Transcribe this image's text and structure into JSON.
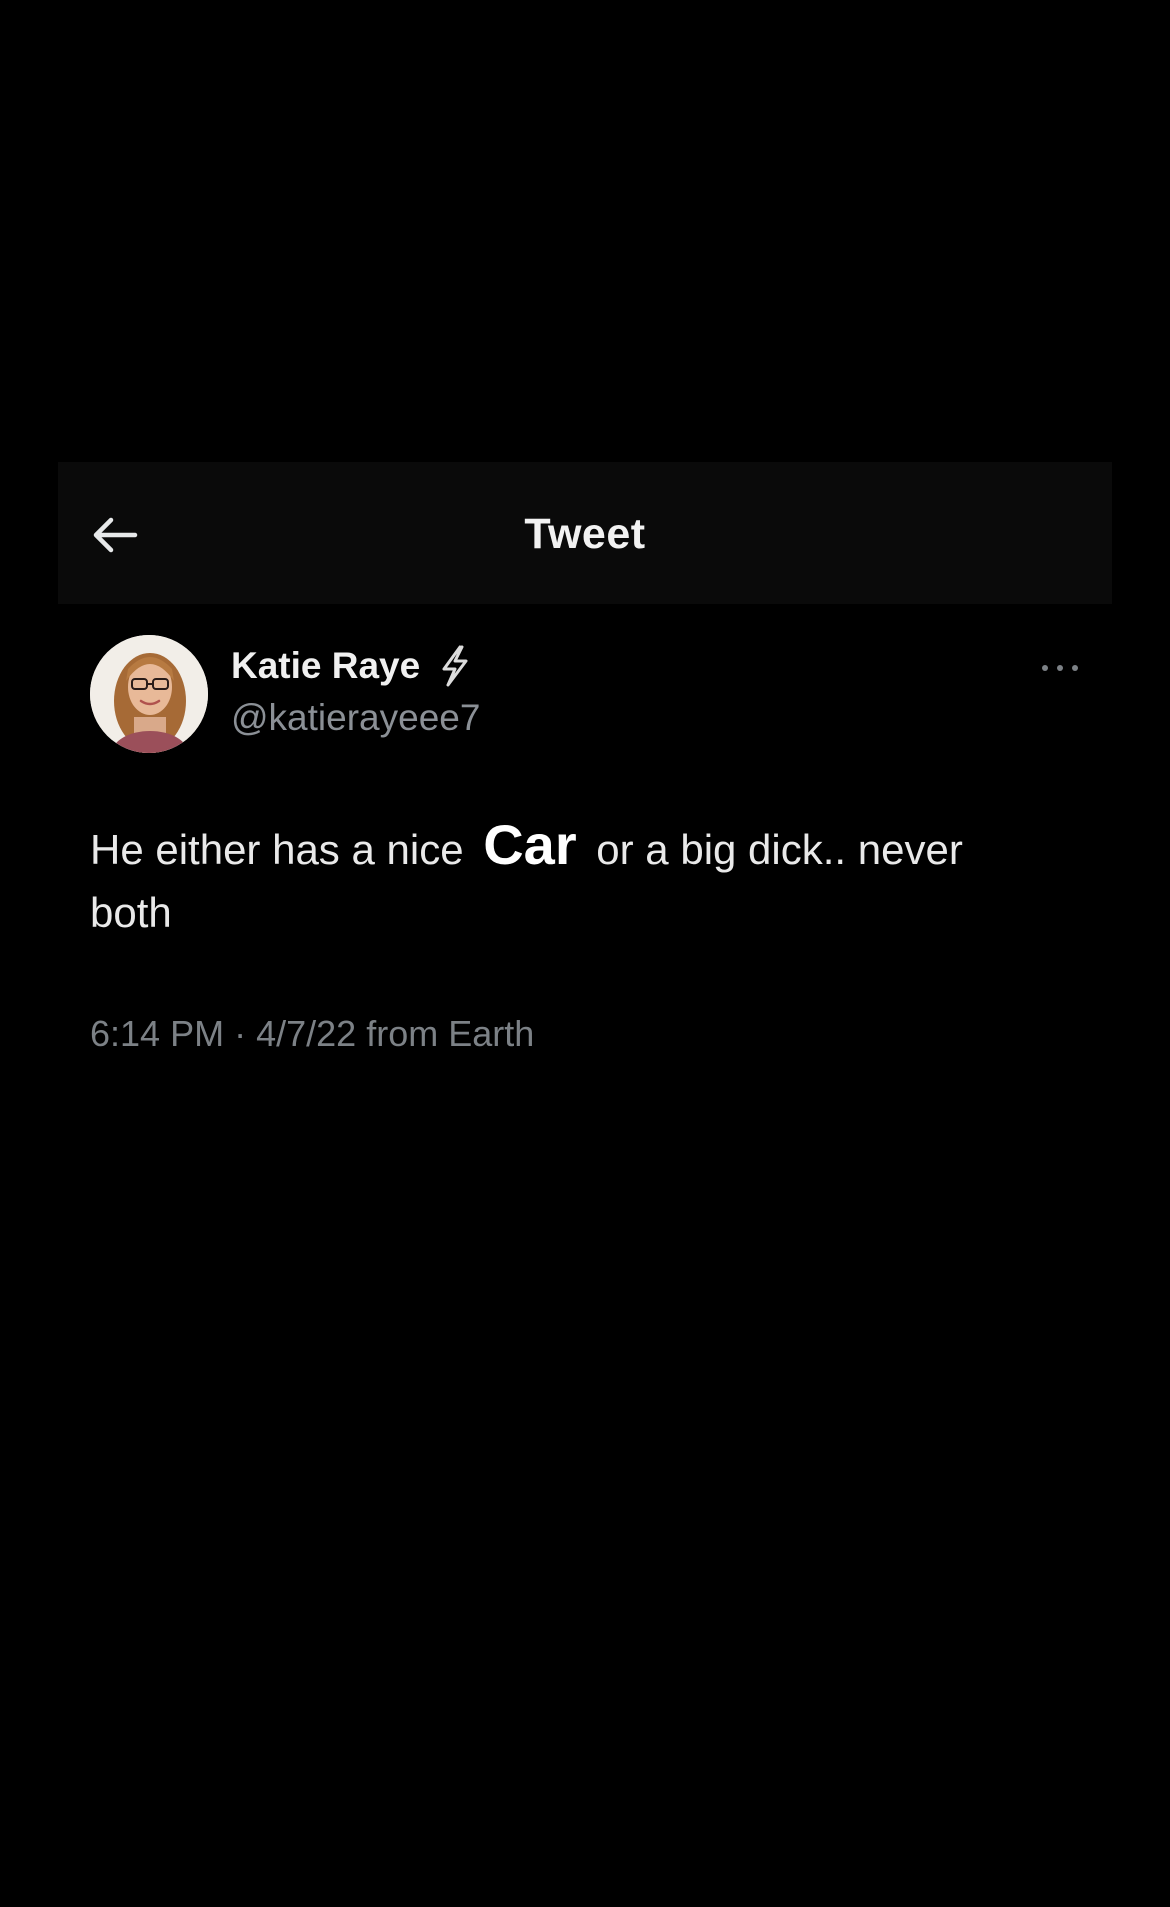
{
  "header": {
    "title": "Tweet",
    "back_icon": "arrow-left-icon"
  },
  "tweet": {
    "author": {
      "name": "Katie Raye",
      "badge_icon": "lightning-bolt-icon",
      "handle": "@katierayeee7"
    },
    "more_icon": "ellipsis-icon",
    "text": {
      "before": "He either has a nice",
      "emphasis": "Car",
      "after": "or a big dick.. never both"
    },
    "time": "6:14 PM",
    "separator": "·",
    "date": "4/7/22",
    "source": "from Earth"
  },
  "colors": {
    "background": "#000000",
    "header_background": "#0a0a0a",
    "primary_text": "#e7e9ea",
    "secondary_text": "#8b9096",
    "bolt": "#dcdcdc"
  }
}
